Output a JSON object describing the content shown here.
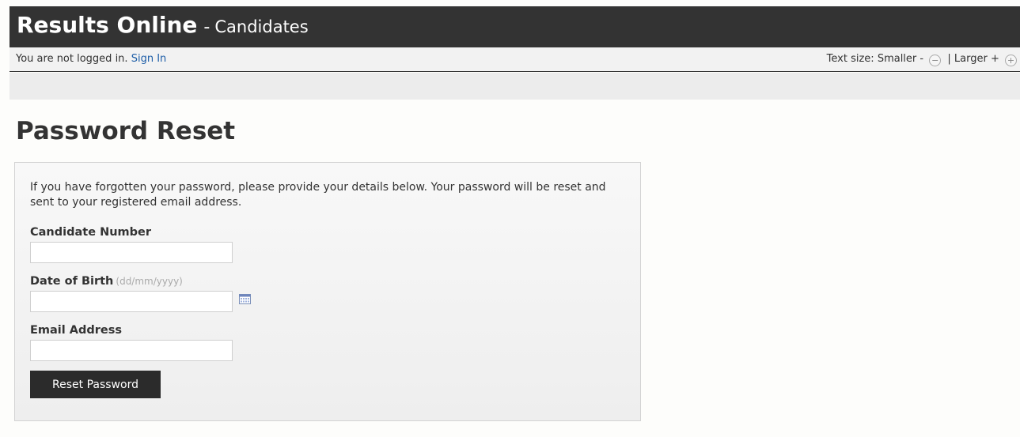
{
  "header": {
    "app_title": "Results Online",
    "separator": "-",
    "subtitle": "Candidates"
  },
  "userbar": {
    "status_text": "You are not logged in.",
    "sign_in_label": "Sign In",
    "text_size_label": "Text size:",
    "smaller_label": "Smaller -",
    "smaller_icon": "−",
    "divider": "|",
    "larger_label": "Larger +",
    "larger_icon": "+"
  },
  "page": {
    "title": "Password Reset",
    "intro": "If you have forgotten your password, please provide your details below. Your password will be reset and sent to your registered email address."
  },
  "form": {
    "candidate_number": {
      "label": "Candidate Number",
      "value": "",
      "placeholder": ""
    },
    "date_of_birth": {
      "label": "Date of Birth",
      "hint": "(dd/mm/yyyy)",
      "value": "",
      "placeholder": ""
    },
    "email": {
      "label": "Email Address",
      "value": "",
      "placeholder": ""
    },
    "submit_label": "Reset Password"
  },
  "icons": {
    "calendar": "calendar-icon"
  },
  "colors": {
    "header_bg": "#333333",
    "link": "#1f5fa8",
    "button_bg": "#2b2b2b"
  }
}
